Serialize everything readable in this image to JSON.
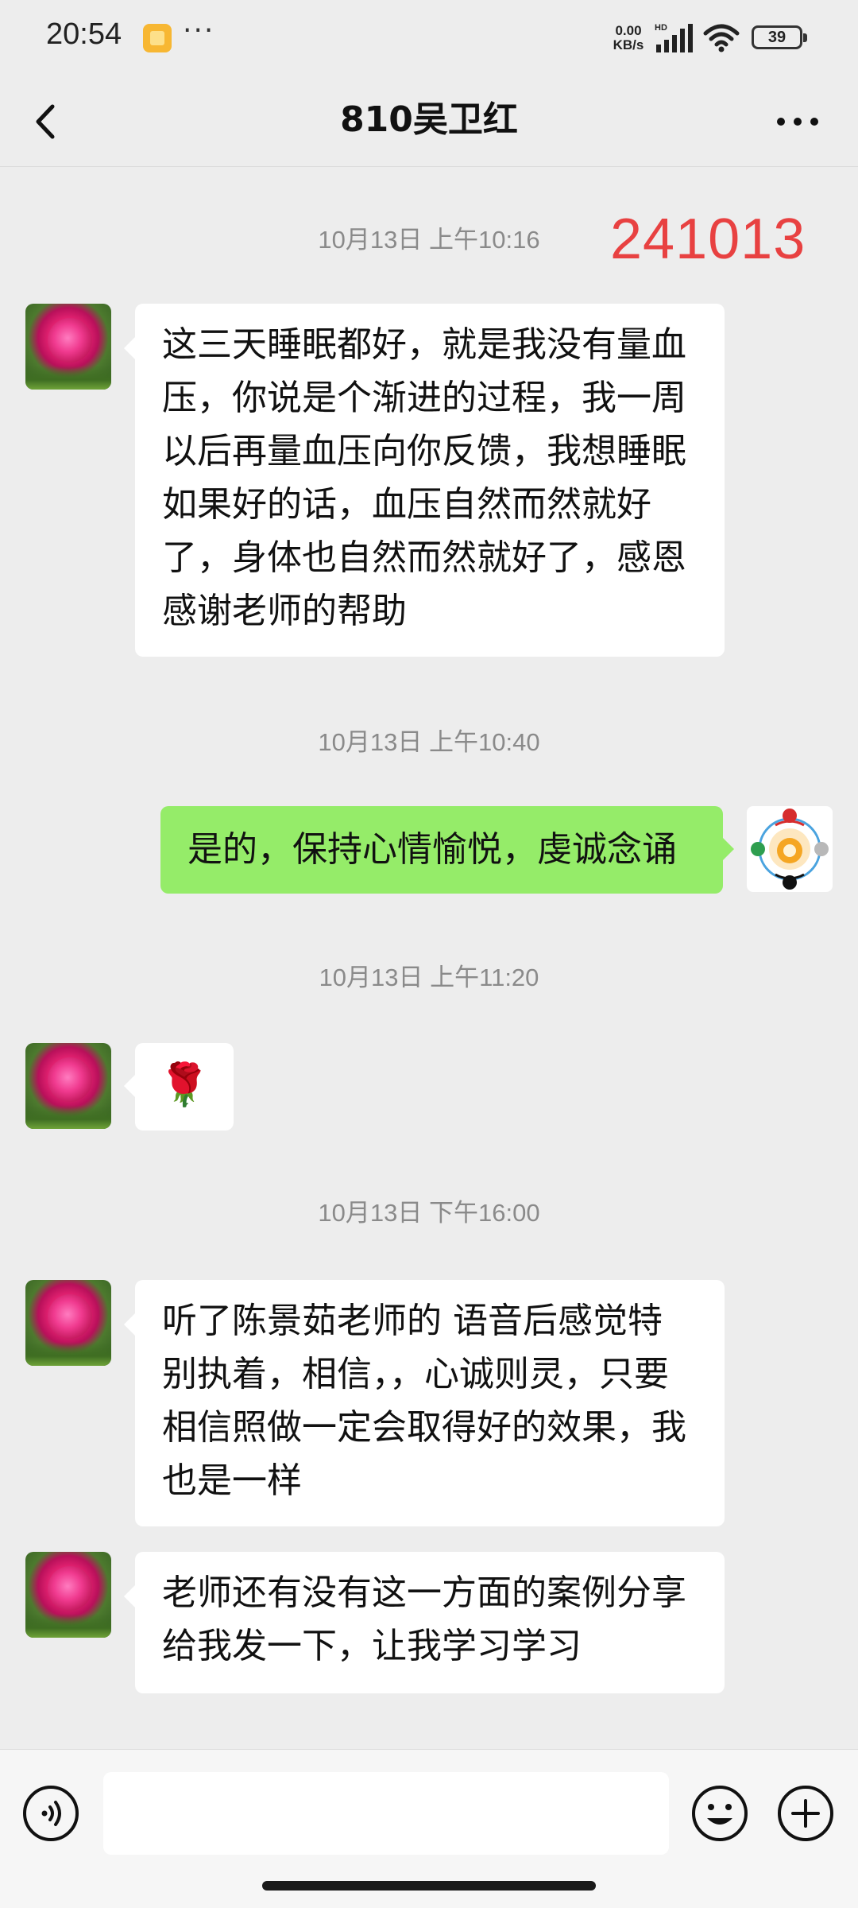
{
  "status_bar": {
    "time": "20:54",
    "dots": "···",
    "net_speed_value": "0.00",
    "net_speed_unit": "KB/s",
    "network_type": "HD",
    "battery": "39"
  },
  "header": {
    "title": "810吴卫红",
    "back_icon": "chevron-left-icon",
    "more_icon": "more-dots-icon"
  },
  "chat": {
    "stamp": "241013",
    "messages": [
      {
        "type": "time",
        "text": "10月13日 上午10:16"
      },
      {
        "type": "received",
        "text": "这三天睡眠都好，就是我没有量血\n压，你说是个渐进的过程，我一周\n以后再量血压向你反馈，我想睡眠\n如果好的话，血压自然而然就好\n了，身体也自然而然就好了，感恩\n感谢老师的帮助"
      },
      {
        "type": "time",
        "text": "10月13日 上午10:40"
      },
      {
        "type": "sent",
        "text": "是的，保持心情愉悦，虔诚念诵"
      },
      {
        "type": "time",
        "text": "10月13日 上午11:20"
      },
      {
        "type": "received",
        "text": "🌹"
      },
      {
        "type": "time",
        "text": "10月13日 下午16:00"
      },
      {
        "type": "received",
        "text": "听了陈景茹老师的 语音后感觉特\n别执着，相信，，心诚则灵，只要\n相信照做一定会取得好的效果，我\n也是一样"
      },
      {
        "type": "received",
        "text": "老师还有没有这一方面的案例分享\n给我发一下，让我学习学习"
      }
    ]
  },
  "input_bar": {
    "value": "",
    "voice_icon": "voice-icon",
    "emoji_icon": "emoji-icon",
    "plus_icon": "plus-icon"
  },
  "colors": {
    "background": "#ededed",
    "sent_bubble": "#95ec69",
    "received_bubble": "#ffffff",
    "stamp": "#e84141",
    "timestamp": "#8a8a8a"
  }
}
